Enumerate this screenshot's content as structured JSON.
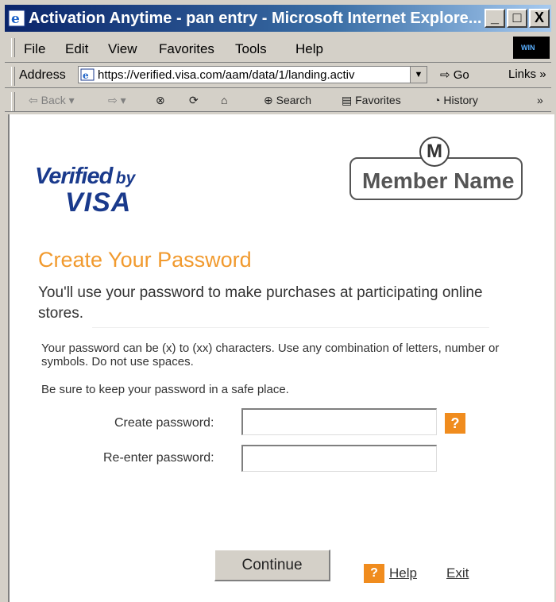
{
  "window": {
    "title": "Activation Anytime - pan entry - Microsoft Internet Explore...",
    "buttons": {
      "minimize": "_",
      "maximize": "□",
      "close": "X"
    }
  },
  "menubar": {
    "items": [
      "File",
      "Edit",
      "View",
      "Favorites",
      "Tools",
      "Help"
    ]
  },
  "addressbar": {
    "label": "Address",
    "url": "https://verified.visa.com/aam/data/1/landing.activ",
    "go_label": "Go",
    "links_label": "Links"
  },
  "toolbar": {
    "back_label": "Back",
    "search_label": "Search",
    "favorites_label": "Favorites",
    "history_label": "History"
  },
  "page": {
    "logo": {
      "line1": "Verified",
      "line1b": "by",
      "line2": "VISA"
    },
    "member": {
      "badge": "M",
      "text": "Member Name"
    },
    "heading": "Create Your Password",
    "intro": "You'll use your password to make purchases at participating online stores.",
    "note1": "Your password can be (x) to (xx) characters. Use any combination of letters, number or symbols. Do not use spaces.",
    "note2": "Be sure to keep your password in a safe place.",
    "create_label": "Create password:",
    "reenter_label": "Re-enter password:",
    "help_icon": "?",
    "continue_label": "Continue",
    "help_label": "Help",
    "exit_label": "Exit"
  },
  "colors": {
    "titlebar_start": "#0a246a",
    "heading": "#f19a2e",
    "logo_blue": "#1a3a8c",
    "help_orange": "#f08c1e"
  },
  "icons": [
    "ie-icon",
    "windows-logo-icon",
    "page-icon",
    "dropdown-arrow-icon",
    "go-icon",
    "back-arrow-icon",
    "forward-arrow-icon",
    "stop-icon",
    "refresh-icon",
    "home-icon",
    "search-icon",
    "favorites-icon",
    "history-icon",
    "help-question-icon"
  ]
}
